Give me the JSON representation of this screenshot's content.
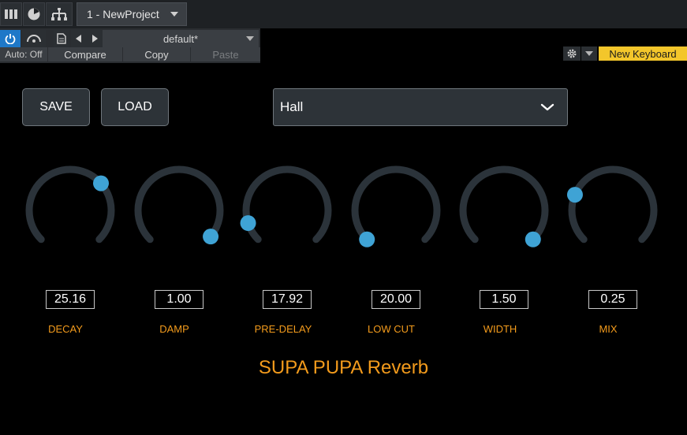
{
  "host": {
    "project_tab": "1 - NewProject",
    "auto_label": "Auto: Off",
    "preset_name": "default*",
    "compare_label": "Compare",
    "copy_label": "Copy",
    "paste_label": "Paste",
    "keyboard_label": "New Keyboard"
  },
  "plugin": {
    "save_label": "SAVE",
    "load_label": "LOAD",
    "preset_selected": "Hall",
    "title": "SUPA PUPA Reverb",
    "knobs": [
      {
        "label": "DECAY",
        "value": "25.16",
        "fraction": 0.68
      },
      {
        "label": "DAMP",
        "value": "1.00",
        "fraction": 0.98
      },
      {
        "label": "PRE-DELAY",
        "value": "17.92",
        "fraction": 0.1
      },
      {
        "label": "LOW CUT",
        "value": "20.00",
        "fraction": 0.0
      },
      {
        "label": "WIDTH",
        "value": "1.50",
        "fraction": 1.0
      },
      {
        "label": "MIX",
        "value": "0.25",
        "fraction": 0.25
      }
    ]
  },
  "colors": {
    "accent": "#f39b1c",
    "knob_track": "#2b333a",
    "knob_thumb": "#3fa3d5",
    "keyboard_badge": "#f3c62b",
    "power_blue": "#1e78c8"
  },
  "icons": [
    "mixer-icon",
    "browser-icon",
    "routing-icon",
    "power-icon",
    "automation-icon",
    "document-icon",
    "prev-arrow-icon",
    "next-arrow-icon",
    "gear-icon",
    "chevron-down-icon"
  ]
}
